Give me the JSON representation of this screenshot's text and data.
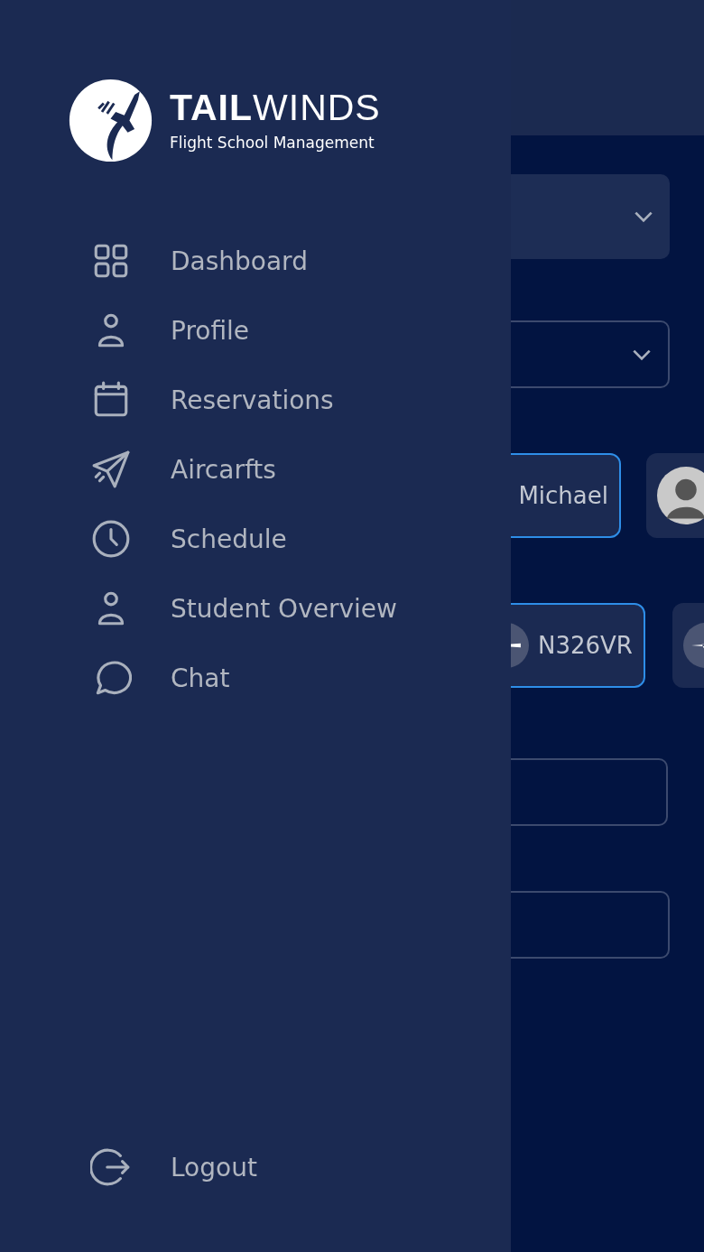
{
  "drawer": {
    "logo": {
      "bold": "TAIL",
      "light": "WINDS",
      "tagline": "Flight School Management"
    },
    "menu": [
      {
        "label": "Dashboard"
      },
      {
        "label": "Profile"
      },
      {
        "label": "Reservations"
      },
      {
        "label": "Aircarfts"
      },
      {
        "label": "Schedule"
      },
      {
        "label": "Student Overview"
      },
      {
        "label": "Chat"
      }
    ],
    "logout": {
      "label": "Logout"
    }
  },
  "form": {
    "instructors": [
      {
        "kind": "name",
        "label": "Michael",
        "selected": true
      },
      {
        "kind": "avatar",
        "selected": false
      }
    ],
    "aircraft": [
      {
        "label": "N326VR",
        "selected": true
      },
      {
        "selected": false
      }
    ]
  }
}
